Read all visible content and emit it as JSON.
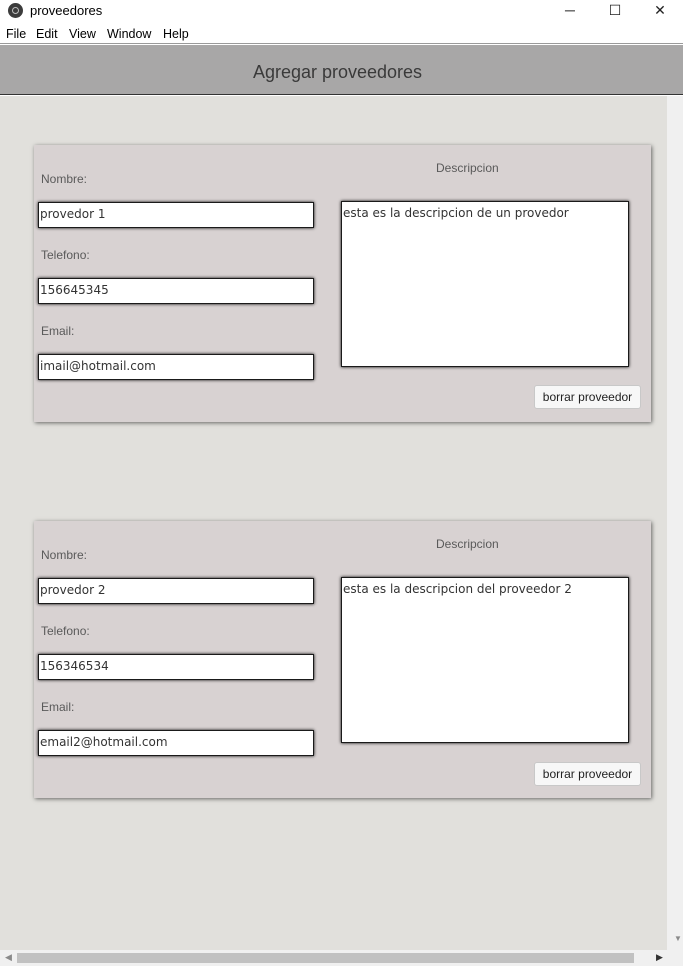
{
  "window": {
    "title": "proveedores",
    "minimize": "─",
    "maximize": "☐",
    "close": "✕"
  },
  "menu": [
    "File",
    "Edit",
    "View",
    "Window",
    "Help"
  ],
  "header": {
    "title": "Agregar proveedores"
  },
  "cards": [
    {
      "nombre_label": "Nombre:",
      "nombre": "provedor 1",
      "telefono_label": "Telefono:",
      "telefono": "156645345",
      "email_label": "Email:",
      "email": "imail@hotmail.com",
      "descripcion_label": "Descripcion",
      "descripcion": "esta es la descripcion de un provedor",
      "delete_label": "borrar proveedor"
    },
    {
      "nombre_label": "Nombre:",
      "nombre": "provedor 2",
      "telefono_label": "Telefono:",
      "telefono": "156346534",
      "email_label": "Email:",
      "email": "email2@hotmail.com",
      "descripcion_label": "Descripcion",
      "descripcion": "esta es la descripcion del proveedor 2",
      "delete_label": "borrar proveedor"
    }
  ],
  "scrollbars": {
    "down_arrow": "▼",
    "left_arrow": "◀",
    "right_arrow": "▶"
  }
}
